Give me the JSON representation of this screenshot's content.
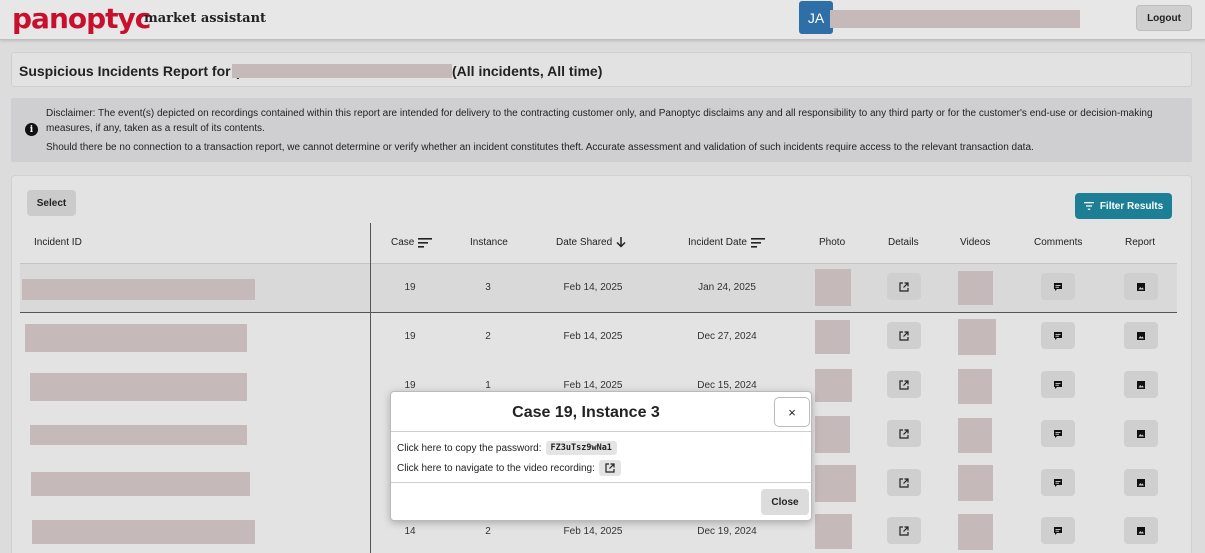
{
  "header": {
    "logo": "panoptyc",
    "tagline": "market assistant",
    "avatar_initials": "JA",
    "logout_label": "Logout"
  },
  "report": {
    "title_prefix": "Suspicious Incidents Report for (",
    "title_suffix": "(All incidents, All time)"
  },
  "disclaimer": {
    "line1": "Disclaimer: The event(s) depicted on recordings contained within this report are intended for delivery to the contracting customer only, and Panoptyc disclaims any and all responsibility to any third party or for the customer's end-use or decision-making measures, if any, taken as a result of its contents.",
    "line2": "Should there be no connection to a transaction report, we cannot determine or verify whether an incident constitutes theft. Accurate assessment and validation of such incidents require access to the relevant transaction data."
  },
  "toolbar": {
    "select_label": "Select",
    "filter_label": "Filter Results"
  },
  "table": {
    "headers": {
      "incident_id": "Incident ID",
      "case": "Case",
      "instance": "Instance",
      "date_shared": "Date Shared",
      "incident_date": "Incident Date",
      "photo": "Photo",
      "details": "Details",
      "videos": "Videos",
      "comments": "Comments",
      "report": "Report"
    },
    "rows": [
      {
        "case": "19",
        "instance": "3",
        "date_shared": "Feb 14, 2025",
        "incident_date": "Jan 24, 2025"
      },
      {
        "case": "19",
        "instance": "2",
        "date_shared": "Feb 14, 2025",
        "incident_date": "Dec 27, 2024"
      },
      {
        "case": "19",
        "instance": "1",
        "date_shared": "Feb 14, 2025",
        "incident_date": "Dec 15, 2024"
      },
      {
        "case": "",
        "instance": "",
        "date_shared": "",
        "incident_date": ""
      },
      {
        "case": "",
        "instance": "",
        "date_shared": "",
        "incident_date": ""
      },
      {
        "case": "14",
        "instance": "2",
        "date_shared": "Feb 14, 2025",
        "incident_date": "Dec 19, 2024"
      }
    ]
  },
  "modal": {
    "title": "Case 19, Instance 3",
    "close_x": "×",
    "copy_password_label": "Click here to copy the password:",
    "password": "FZ3uTsz9wNa1",
    "navigate_label": "Click here to navigate to the video recording:",
    "close_label": "Close"
  },
  "colors": {
    "brand": "#c8102e",
    "accent": "#1d7f96",
    "avatar": "#2f6fa8"
  }
}
